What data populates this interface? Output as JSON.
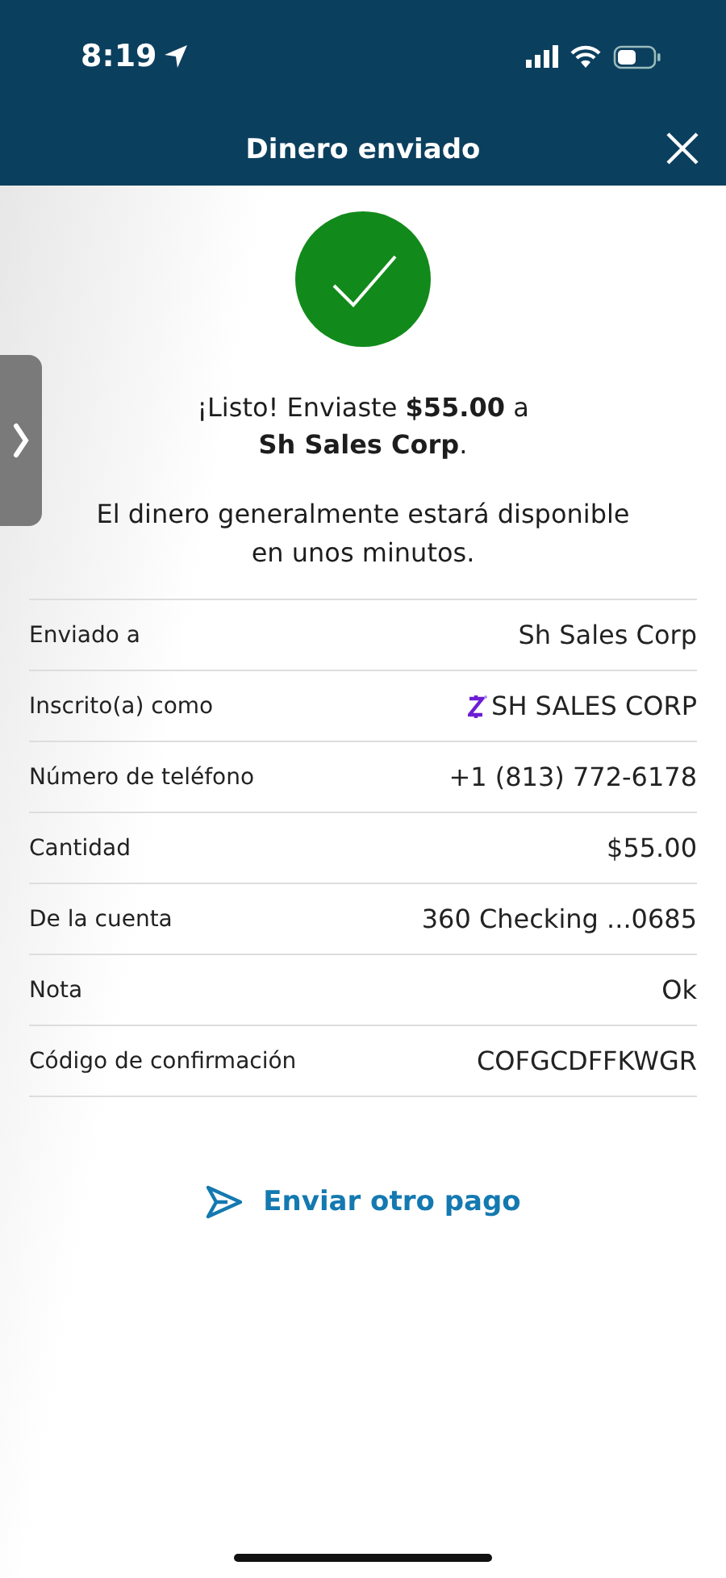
{
  "status_bar": {
    "time": "8:19"
  },
  "header": {
    "title": "Dinero enviado"
  },
  "confirmation": {
    "message": "¡Listo! Enviaste **$55.00** a\n**Sh Sales Corp**.",
    "note": "El dinero generalmente estará disponible en unos minutos."
  },
  "details": [
    {
      "kind": "plain",
      "label": "Enviado a",
      "value": "Sh Sales Corp"
    },
    {
      "kind": "enrolled",
      "label": "Inscrito(a) como",
      "value": "SH SALES CORP"
    },
    {
      "kind": "plain",
      "label": "Número de teléfono",
      "value": "+1 (813) 772-6178"
    },
    {
      "kind": "plain",
      "label": "Cantidad",
      "value": "$55.00"
    },
    {
      "kind": "plain",
      "label": "De la cuenta",
      "value": "360 Checking ...0685"
    },
    {
      "kind": "plain",
      "label": "Nota",
      "value": "Ok"
    },
    {
      "kind": "plain",
      "label": "Código de confirmación",
      "value": "COFGCDFFKWGR"
    }
  ],
  "action": {
    "label": "Enviar otro pago"
  }
}
